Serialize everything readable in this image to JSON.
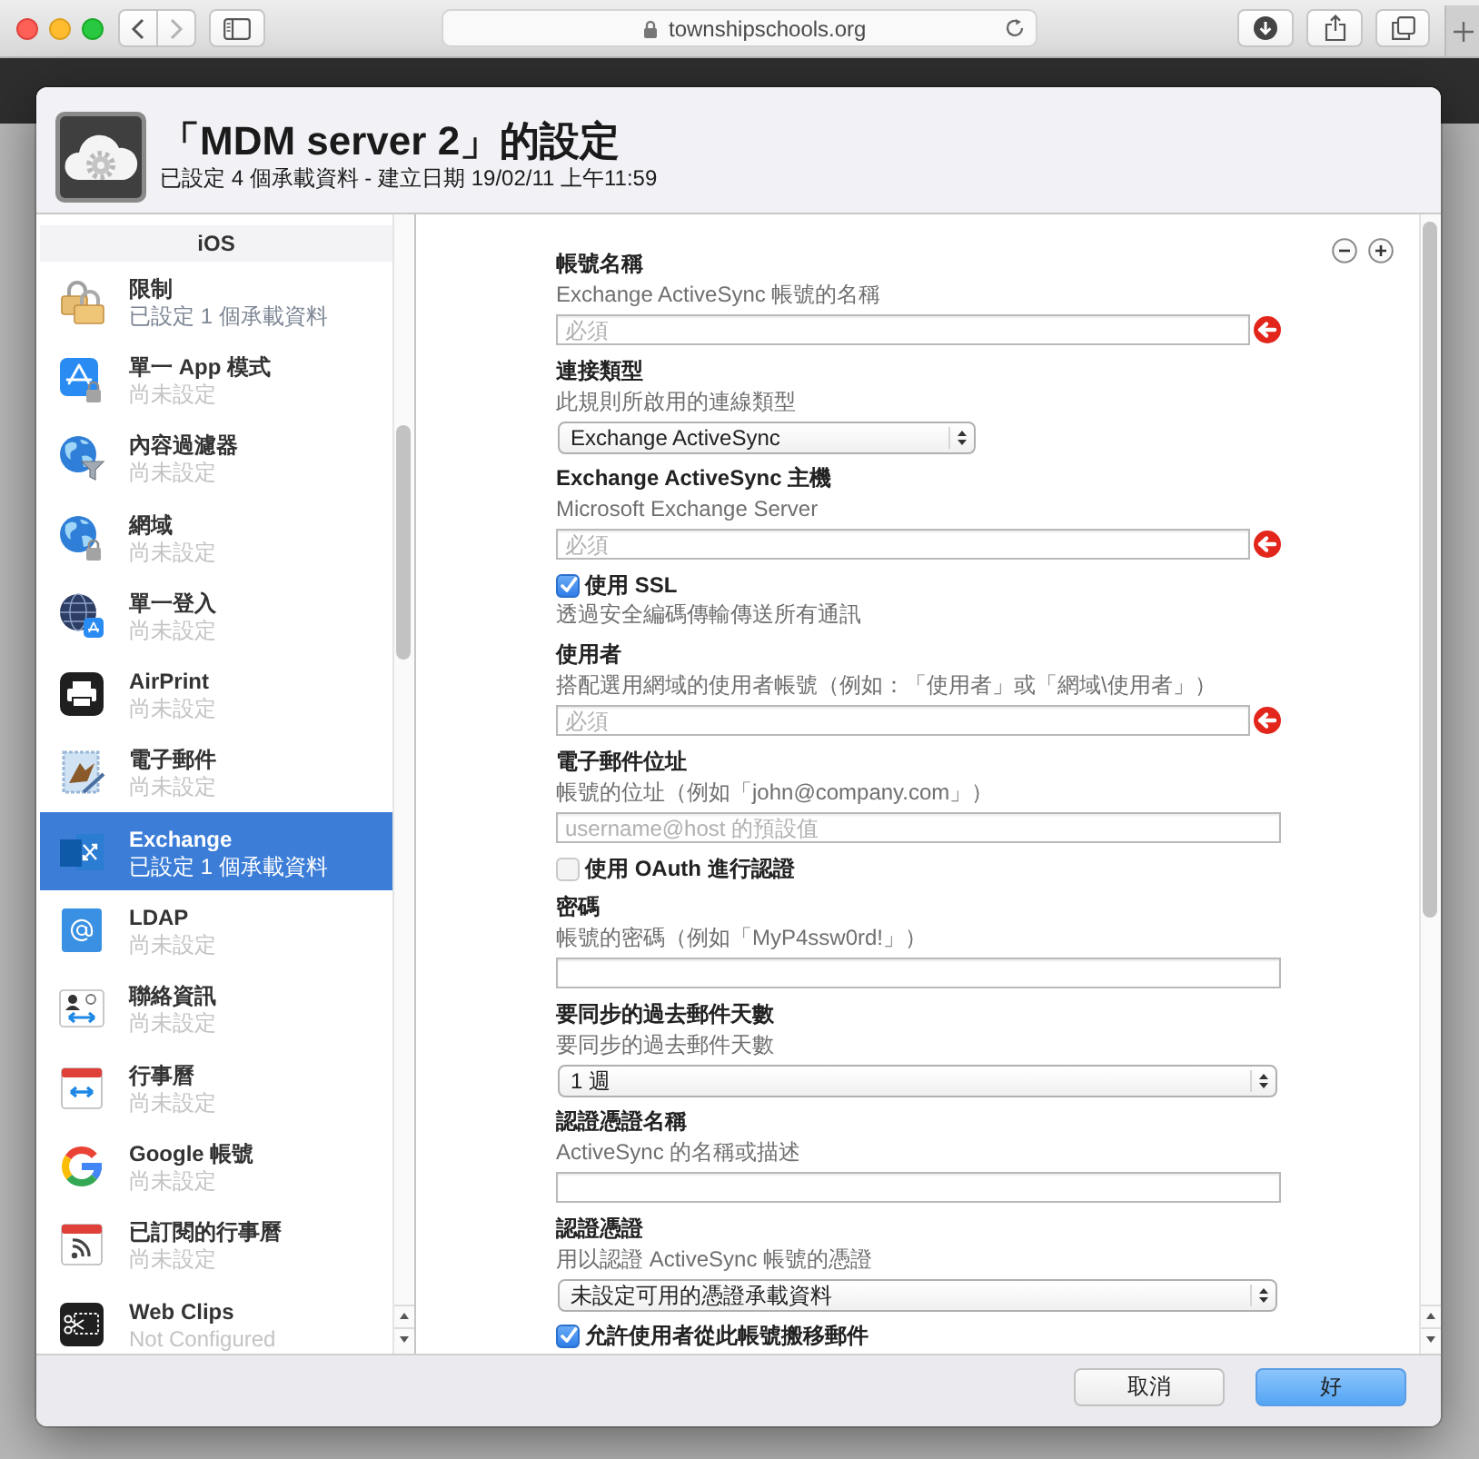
{
  "browser": {
    "url": "townshipschools.org"
  },
  "dialog": {
    "title": "「MDM server 2」的設定",
    "subtitle": "已設定 4 個承載資料 - 建立日期 19/02/11 上午11:59"
  },
  "sidebar": {
    "section": "iOS",
    "items": [
      {
        "title": "限制",
        "subtitle": "已設定 1 個承載資料",
        "configured": true,
        "selected": false
      },
      {
        "title": "單一 App 模式",
        "subtitle": "尚未設定",
        "configured": false,
        "selected": false
      },
      {
        "title": "內容過濾器",
        "subtitle": "尚未設定",
        "configured": false,
        "selected": false
      },
      {
        "title": "網域",
        "subtitle": "尚未設定",
        "configured": false,
        "selected": false
      },
      {
        "title": "單一登入",
        "subtitle": "尚未設定",
        "configured": false,
        "selected": false
      },
      {
        "title": "AirPrint",
        "subtitle": "尚未設定",
        "configured": false,
        "selected": false
      },
      {
        "title": "電子郵件",
        "subtitle": "尚未設定",
        "configured": false,
        "selected": false
      },
      {
        "title": "Exchange",
        "subtitle": "已設定 1 個承載資料",
        "configured": true,
        "selected": true
      },
      {
        "title": "LDAP",
        "subtitle": "尚未設定",
        "configured": false,
        "selected": false
      },
      {
        "title": "聯絡資訊",
        "subtitle": "尚未設定",
        "configured": false,
        "selected": false
      },
      {
        "title": "行事曆",
        "subtitle": "尚未設定",
        "configured": false,
        "selected": false
      },
      {
        "title": "Google 帳號",
        "subtitle": "尚未設定",
        "configured": false,
        "selected": false
      },
      {
        "title": "已訂閱的行事曆",
        "subtitle": "尚未設定",
        "configured": false,
        "selected": false
      },
      {
        "title": "Web Clips",
        "subtitle": "Not Configured",
        "configured": false,
        "selected": false
      }
    ]
  },
  "form": {
    "fields": [
      {
        "kind": "text",
        "label": "帳號名稱",
        "description": "Exchange ActiveSync 帳號的名稱",
        "placeholder": "必須",
        "required": true
      },
      {
        "kind": "select",
        "label": "連接類型",
        "description": "此規則所啟用的連線類型",
        "value": "Exchange ActiveSync"
      },
      {
        "kind": "text",
        "label": "Exchange ActiveSync 主機",
        "description": "Microsoft Exchange Server",
        "placeholder": "必須",
        "required": true
      },
      {
        "kind": "checkbox",
        "label": "使用 SSL",
        "description": "透過安全編碼傳輸傳送所有通訊",
        "checked": true
      },
      {
        "kind": "text",
        "label": "使用者",
        "description": "搭配選用網域的使用者帳號（例如：「使用者」或「網域\\使用者」）",
        "placeholder": "必須",
        "required": true
      },
      {
        "kind": "text",
        "label": "電子郵件位址",
        "description": "帳號的位址（例如「john@company.com」）",
        "placeholder": "username@host 的預設值",
        "required": false
      },
      {
        "kind": "checkbox",
        "label": "使用 OAuth 進行認證",
        "checked": false
      },
      {
        "kind": "text",
        "label": "密碼",
        "description": "帳號的密碼（例如「MyP4ssw0rd!」）",
        "required": false
      },
      {
        "kind": "select",
        "label": "要同步的過去郵件天數",
        "description": "要同步的過去郵件天數",
        "value": "1 週"
      },
      {
        "kind": "text",
        "label": "認證憑證名稱",
        "description": "ActiveSync 的名稱或描述",
        "required": false
      },
      {
        "kind": "select",
        "label": "認證憑證",
        "description": "用以認證 ActiveSync 帳號的憑證",
        "value": "未設定可用的憑證承載資料"
      },
      {
        "kind": "checkbox",
        "label": "允許使用者從此帳號搬移郵件",
        "checked": true
      }
    ]
  },
  "buttons": [
    {
      "label": "取消",
      "default": false
    },
    {
      "label": "好",
      "default": true
    }
  ]
}
